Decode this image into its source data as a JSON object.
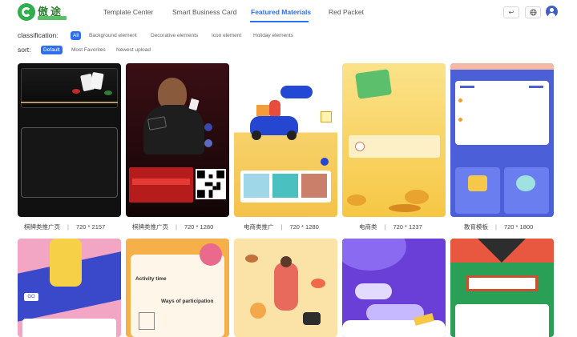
{
  "logo": {
    "text": "傲途"
  },
  "nav": {
    "items": [
      {
        "label": "Template Center"
      },
      {
        "label": "Smart Business Card"
      },
      {
        "label": "Featured Materials"
      },
      {
        "label": "Red Packet"
      }
    ],
    "active_index": 2
  },
  "header_actions": {
    "exit_icon": "↩",
    "language_icon": "globe-icon"
  },
  "filters": {
    "classification": {
      "label": "classification:",
      "options": [
        "All",
        "Background element",
        "Decorative elements",
        "Icon element",
        "Holiday elements"
      ],
      "selected": "All"
    },
    "sort": {
      "label": "sort:",
      "options": [
        "Default",
        "Most Favorites",
        "Newest upload"
      ],
      "selected": "Default"
    }
  },
  "materials": [
    {
      "name": "棋牌类推广页",
      "size": "720 * 2157"
    },
    {
      "name": "棋牌类推广页",
      "size": "720 * 1280"
    },
    {
      "name": "电商类推广",
      "size": "720 * 1280"
    },
    {
      "name": "电商类",
      "size": "720 * 1237"
    },
    {
      "name": "教育模板",
      "size": "720 * 1800"
    }
  ],
  "thumb_text": {
    "activity_time": "Activity time",
    "ways_of_participation": "Ways of participation",
    "go": "GO"
  },
  "colors": {
    "accent": "#2f6fed",
    "brand_green": "#2fae4e"
  }
}
